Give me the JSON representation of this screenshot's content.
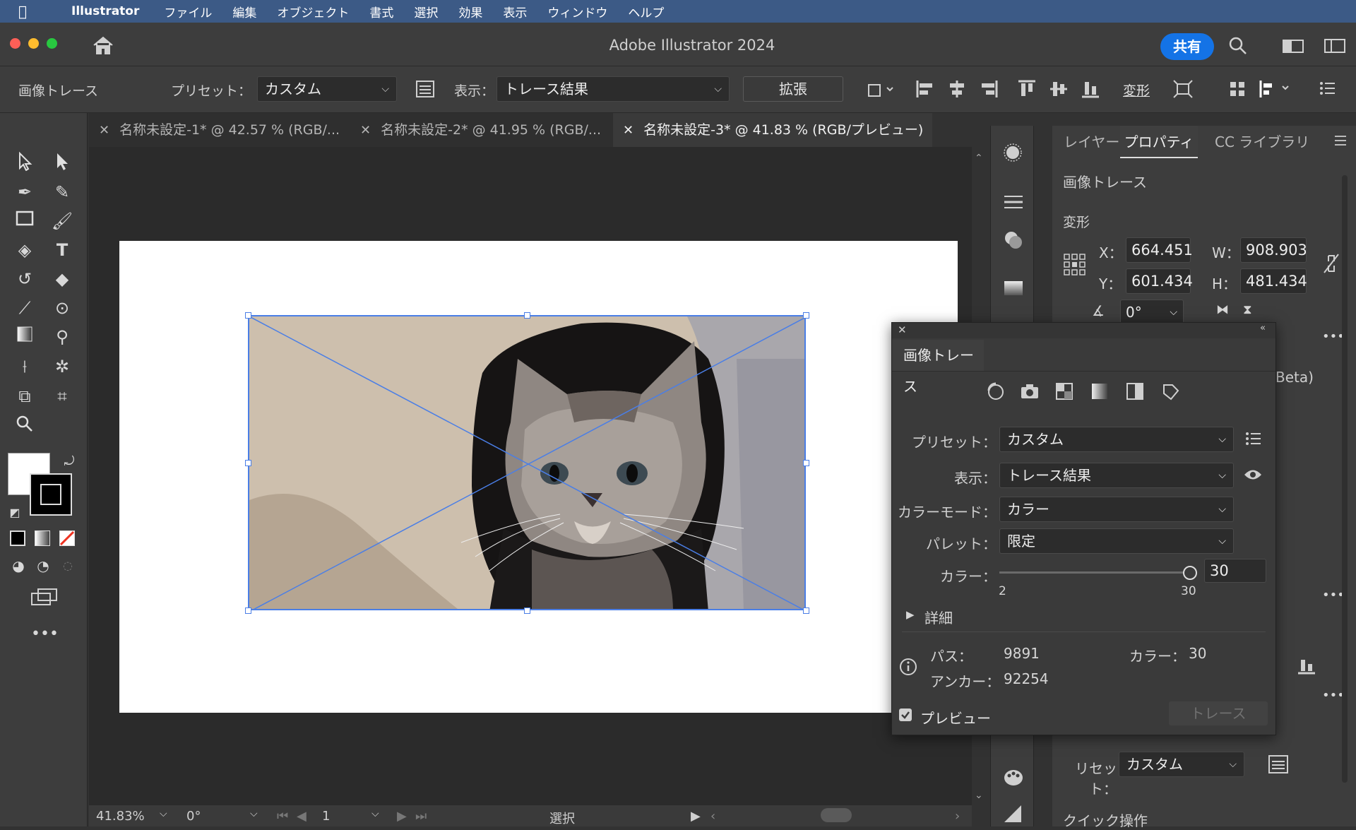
{
  "menubar": {
    "app": "Illustrator",
    "items": [
      "ファイル",
      "編集",
      "オブジェクト",
      "書式",
      "選択",
      "効果",
      "表示",
      "ウィンドウ",
      "ヘルプ"
    ]
  },
  "window": {
    "title": "Adobe Illustrator 2024",
    "share": "共有"
  },
  "control": {
    "context": "画像トレース",
    "preset_label": "プリセット：",
    "preset_value": "カスタム",
    "view_label": "表示：",
    "view_value": "トレース結果",
    "expand": "拡張",
    "transform": "変形"
  },
  "tabs": [
    {
      "label": "名称未設定-1* @ 42.57 % (RGB/..."
    },
    {
      "label": "名称未設定-2* @ 41.95 % (RGB/..."
    },
    {
      "label": "名称未設定-3* @ 41.83 % (RGB/プレビュー)"
    }
  ],
  "status": {
    "zoom": "41.83%",
    "rotate": "0°",
    "page": "1",
    "mode": "選択"
  },
  "right_panel": {
    "tabs": [
      "レイヤー",
      "プロパティ",
      "CC ライブラリ"
    ],
    "section": "画像トレース",
    "transform_heading": "変形",
    "x_label": "X：",
    "x": "664.451",
    "w_label": "W：",
    "w": "908.903",
    "y_label": "Y：",
    "y": "601.434",
    "h_label": "H：",
    "h": "481.434",
    "angle": "0°",
    "beta": "Beta)",
    "preset_label": "リセット：",
    "preset_value": "カスタム",
    "quick": "クイック操作"
  },
  "trace_dialog": {
    "title": "画像トレース",
    "preset_label": "プリセット：",
    "preset_value": "カスタム",
    "view_label": "表示：",
    "view_value": "トレース結果",
    "mode_label": "カラーモード：",
    "mode_value": "カラー",
    "palette_label": "パレット：",
    "palette_value": "限定",
    "colors_label": "カラー：",
    "colors_value": "30",
    "colors_min": "2",
    "colors_max": "30",
    "colors_level": 1.0,
    "advanced": "詳細",
    "paths_label": "パス：",
    "paths_value": "9891",
    "colors_info_label": "カラー：",
    "colors_info_value": "30",
    "anchors_label": "アンカー：",
    "anchors_value": "92254",
    "preview_label": "プレビュー",
    "preview_checked": true,
    "trace_button": "トレース"
  },
  "colors": {
    "accent": "#1473e6",
    "selection": "#4a7ee6",
    "panel": "#3d3d3d",
    "menubar": "#3c5a86"
  }
}
